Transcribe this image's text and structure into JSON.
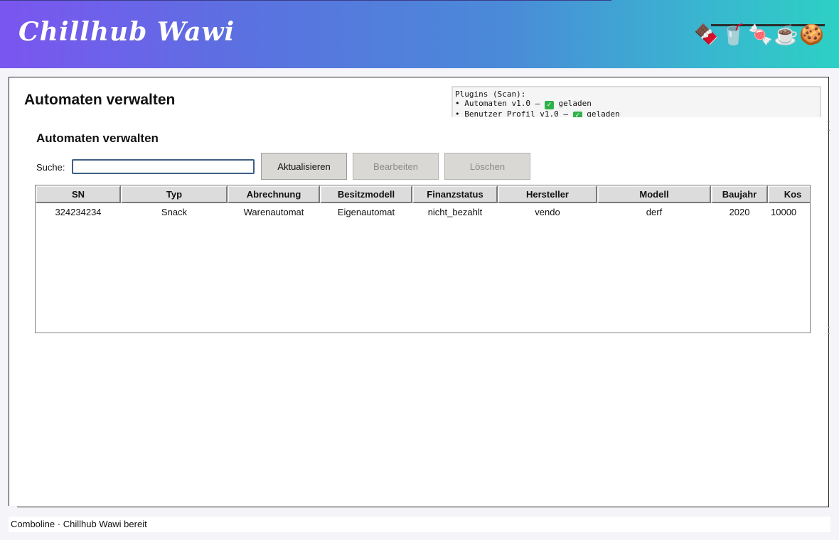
{
  "app": {
    "title": "Chillhub Wawi"
  },
  "header": {
    "emojis": [
      {
        "icon": "chocolate-bar-icon",
        "glyph": "🍫"
      },
      {
        "icon": "coffee-cup-icon",
        "glyph": "🥤"
      },
      {
        "icon": "candy-icon",
        "glyph": "🍬"
      },
      {
        "icon": "hot-coffee-icon",
        "glyph": "☕"
      },
      {
        "icon": "cookie-icon",
        "glyph": "🍪"
      }
    ],
    "gradient": [
      "#7b55f0",
      "#2dd0c4"
    ]
  },
  "page": {
    "title": "Automaten verwalten"
  },
  "plugins": {
    "header": "Plugins (Scan):",
    "items": [
      {
        "prefix": "• Automaten v1.0 – ",
        "status": "geladen"
      },
      {
        "prefix": "• Benutzer Profil v1.0 – ",
        "status": "geladen"
      }
    ]
  },
  "section": {
    "title": "Automaten verwalten"
  },
  "search": {
    "label": "Suche:",
    "value": ""
  },
  "toolbar": {
    "refresh_label": "Aktualisieren",
    "edit_label": "Bearbeiten",
    "delete_label": "Löschen"
  },
  "table": {
    "columns": [
      "SN",
      "Typ",
      "Abrechnung",
      "Besitzmodell",
      "Finanzstatus",
      "Hersteller",
      "Modell",
      "Baujahr",
      "Kos"
    ],
    "rows": [
      [
        "324234234",
        "Snack",
        "Warenautomat",
        "Eigenautomat",
        "nicht_bezahlt",
        "vendo",
        "derf",
        "2020",
        "10000"
      ]
    ]
  },
  "status": {
    "text": "Comboline · Chillhub Wawi bereit"
  }
}
